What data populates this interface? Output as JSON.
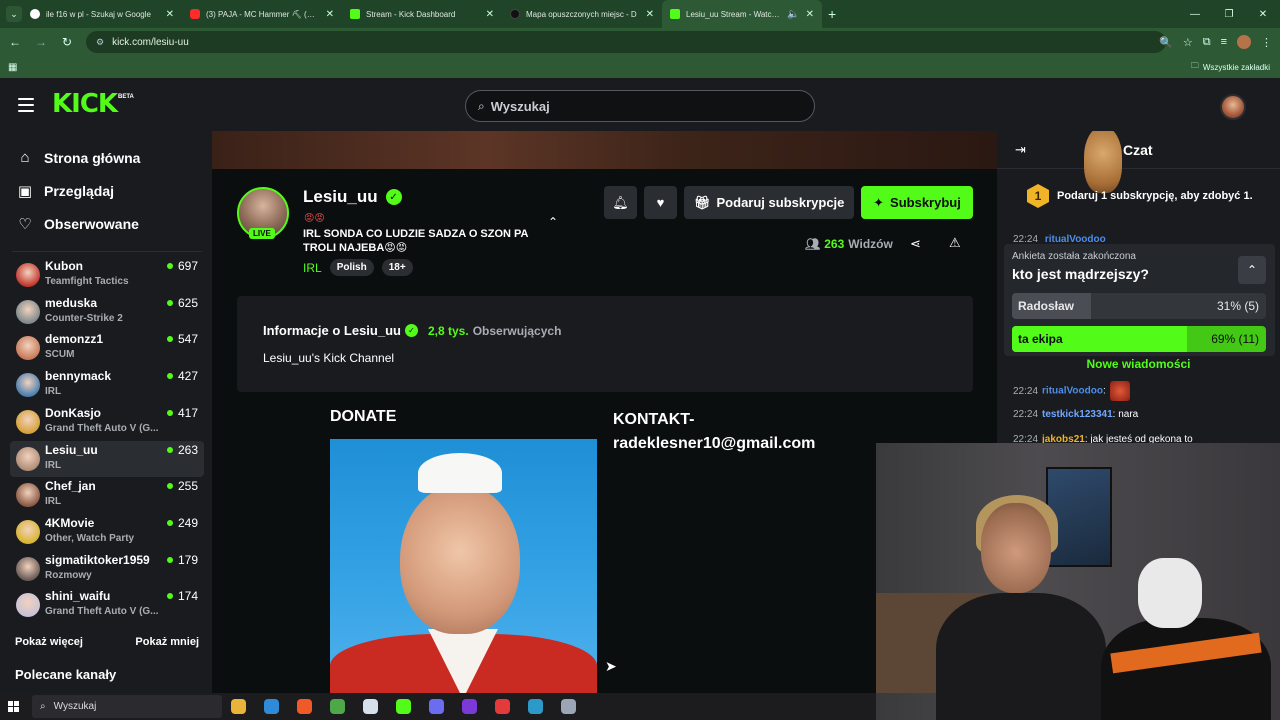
{
  "browser": {
    "tabs": [
      {
        "title": "ile f16 w pl - Szukaj w Google",
        "color": "#ffffff"
      },
      {
        "title": "(3) PAJA - MC Hammer ⛏ (Offic",
        "color": "#ff2b2b"
      },
      {
        "title": "Stream - Kick Dashboard",
        "color": "#53fc18"
      },
      {
        "title": "Mapa opuszczonych miejsc - D",
        "color": "#111111"
      },
      {
        "title": "Lesiu_uu Stream - Watch Li",
        "color": "#53fc18"
      }
    ],
    "url": "kick.com/lesiu-uu",
    "all_bookmarks": "Wszystkie zakładki"
  },
  "header": {
    "logo": "KICK",
    "beta": "BETA",
    "search_placeholder": "Wyszukaj"
  },
  "sidebar": {
    "nav": [
      {
        "label": "Strona główna",
        "icon": "home-icon"
      },
      {
        "label": "Przeglądaj",
        "icon": "browse-icon"
      },
      {
        "label": "Obserwowane",
        "icon": "heart-icon"
      }
    ],
    "channels": [
      {
        "name": "Kubon",
        "category": "Teamfight Tactics",
        "viewers": "697",
        "color": "#c3382f"
      },
      {
        "name": "meduska",
        "category": "Counter-Strike 2",
        "viewers": "625",
        "color": "#7f8a8c"
      },
      {
        "name": "demonzz1",
        "category": "SCUM",
        "viewers": "547",
        "color": "#c97a5a"
      },
      {
        "name": "bennymack",
        "category": "IRL",
        "viewers": "427",
        "color": "#4c7fb0"
      },
      {
        "name": "DonKasjo",
        "category": "Grand Theft Auto V (G...",
        "viewers": "417",
        "color": "#d7a23b"
      },
      {
        "name": "Lesiu_uu",
        "category": "IRL",
        "viewers": "263",
        "color": "#b08f7a"
      },
      {
        "name": "Chef_jan",
        "category": "IRL",
        "viewers": "255",
        "color": "#8c5a45"
      },
      {
        "name": "4KMovie",
        "category": "Other, Watch Party",
        "viewers": "249",
        "color": "#d9b531"
      },
      {
        "name": "sigmatiktoker1959",
        "category": "Rozmowy",
        "viewers": "179",
        "color": "#6b5c58"
      },
      {
        "name": "shini_waifu",
        "category": "Grand Theft Auto V (G...",
        "viewers": "174",
        "color": "#c9c2d6"
      }
    ],
    "show_more": "Pokaż więcej",
    "show_less": "Pokaż mniej",
    "recommended": "Polecane kanały"
  },
  "stream": {
    "name": "Lesiu_uu",
    "live": "LIVE",
    "emotes": "😡😡",
    "title": "IRL SONDA CO LUDZIE SADZA O SZON PA TROLI NAJEBA😡😡",
    "category": "IRL",
    "tags": [
      "Polish",
      "18+"
    ],
    "gift_label": "Podaruj subskrypcje",
    "subscribe_label": "Subskrybuj",
    "viewers": "263",
    "viewers_label": "Widzów"
  },
  "about": {
    "title": "Informacje o Lesiu_uu",
    "followers": "2,8 tys.",
    "followers_label": "Obserwujących",
    "description": "Lesiu_uu's Kick Channel"
  },
  "panels": {
    "donate_title": "DONATE",
    "contact_title": "KONTAKT-radeklesner10@gmail.com"
  },
  "chat": {
    "title": "Czat",
    "sub_goal_badge": "1",
    "sub_goal_text": "Podaruj 1 subskrypcję, aby zdobyć 1.",
    "top_msg": {
      "time": "22:24",
      "user": "ritualVoodoo",
      "color": "#4d8de8"
    },
    "poll": {
      "ended": "Ankieta została zakończona",
      "question": "kto jest mądrzejszy?",
      "options": [
        {
          "label": "Radosław",
          "pct": "31% (5)",
          "share": 31,
          "winner": false
        },
        {
          "label": "ta ekipa",
          "pct": "69% (11)",
          "share": 69,
          "winner": true
        }
      ]
    },
    "new_messages": "Nowe wiadomości",
    "messages": [
      {
        "time": "22:24",
        "user": "ritualVoodoo",
        "text": "",
        "color": "#4d8de8"
      },
      {
        "time": "22:24",
        "user": "testkick123341",
        "text": "nara",
        "color": "#6fa8ff"
      },
      {
        "time": "22:24",
        "user": "jakobs21",
        "text": "jak jesteś od gekona to",
        "color": "#f0b429"
      }
    ]
  },
  "taskbar": {
    "search": "Wyszukaj",
    "apps": [
      "#e8b43a",
      "#2f8ad8",
      "#f05a28",
      "#4ea84a",
      "#d5e0ec",
      "#53fc18",
      "#6c6cf0",
      "#7b3ad8",
      "#e33a3a",
      "#2b9ac8",
      "#9aa5b5"
    ]
  }
}
